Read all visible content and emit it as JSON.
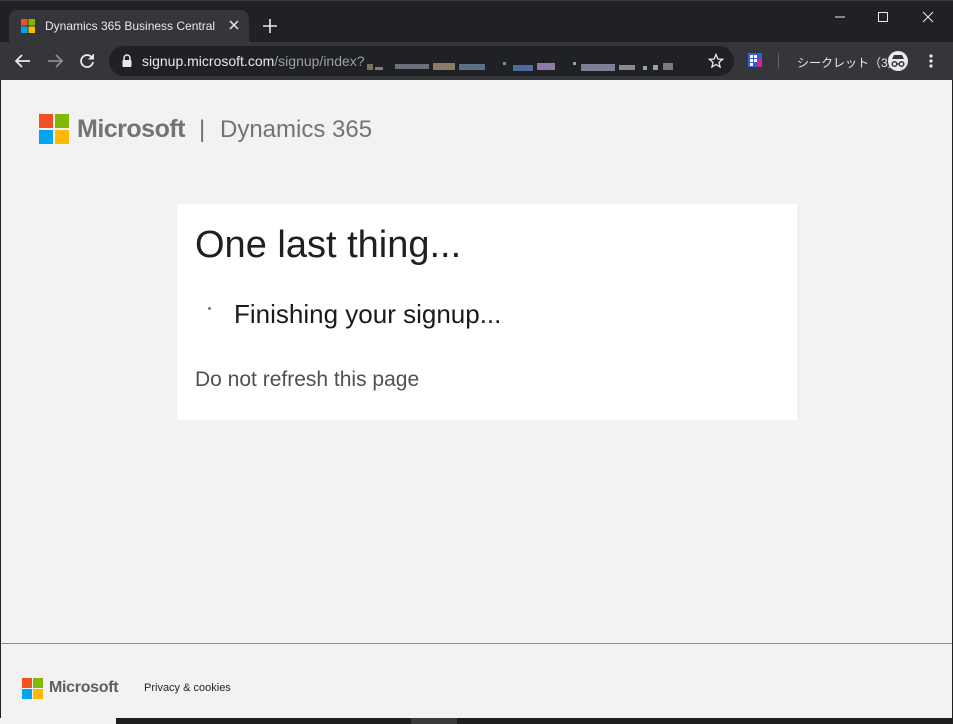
{
  "browser": {
    "tab_title": "Dynamics 365 Business Central",
    "url_host": "signup.microsoft.com",
    "url_path": "/signup/index?",
    "incognito_label": "シークレット（3）"
  },
  "header": {
    "brand": "Microsoft",
    "separator": "|",
    "product": "Dynamics 365"
  },
  "card": {
    "title": "One last thing...",
    "status": "Finishing your signup...",
    "warning": "Do not refresh this page"
  },
  "footer": {
    "brand": "Microsoft",
    "privacy_link": "Privacy & cookies"
  },
  "colors": {
    "ms_red": "#f25022",
    "ms_green": "#7fba00",
    "ms_blue": "#00a4ef",
    "ms_yellow": "#ffb900",
    "page_bg": "#f2f2f2",
    "chrome_dark": "#202124",
    "chrome_toolbar": "#35363a"
  },
  "icons": [
    "microsoft-logo-icon",
    "close-icon",
    "plus-icon",
    "minimize-icon",
    "maximize-icon",
    "back-arrow-icon",
    "forward-arrow-icon",
    "reload-icon",
    "lock-icon",
    "star-icon",
    "extension-icon",
    "incognito-icon",
    "kebab-menu-icon"
  ]
}
